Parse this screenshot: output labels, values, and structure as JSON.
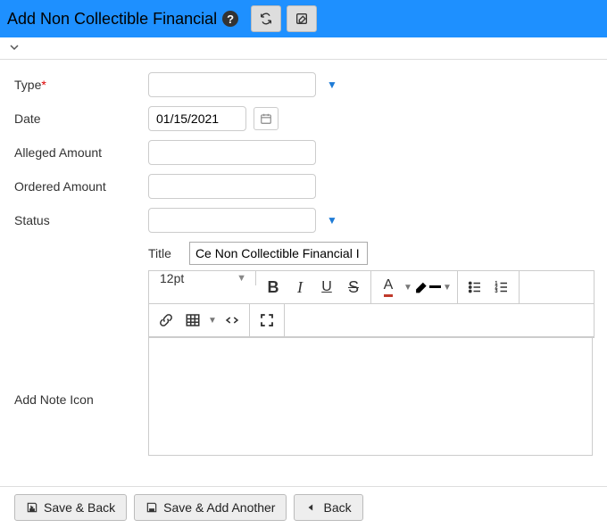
{
  "header": {
    "title": "Add Non Collectible Financial"
  },
  "form": {
    "type": {
      "label": "Type",
      "required": "*",
      "value": ""
    },
    "date": {
      "label": "Date",
      "value": "01/15/2021"
    },
    "alleged": {
      "label": "Alleged Amount",
      "value": ""
    },
    "ordered": {
      "label": "Ordered Amount",
      "value": ""
    },
    "status": {
      "label": "Status",
      "value": ""
    }
  },
  "note": {
    "title_label": "Title",
    "title_value": "Ce Non Collectible Financial I",
    "add_label": "Add Note Icon",
    "font_size": "12pt",
    "bold": "B",
    "italic": "I",
    "underline": "U",
    "strike": "S",
    "textcolor": "A"
  },
  "footer": {
    "save_back": "Save & Back",
    "save_another": "Save & Add Another",
    "back": "Back"
  }
}
